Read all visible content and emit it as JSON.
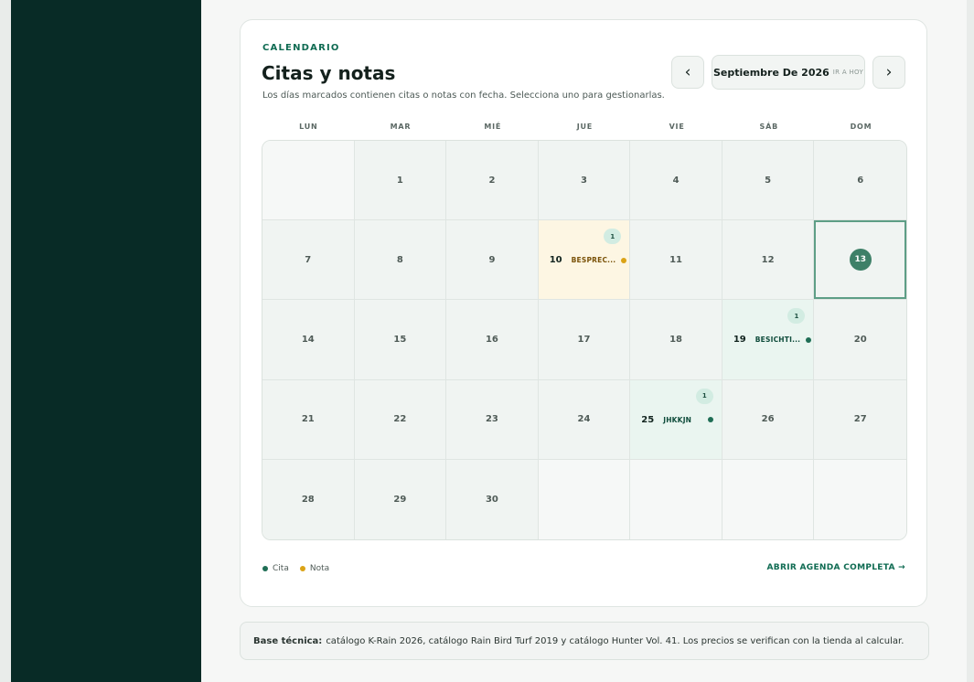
{
  "calendar": {
    "eyebrow": "CALENDARIO",
    "title": "Citas y notas",
    "subtitle": "Los días marcados contienen citas o notas con fecha. Selecciona uno para gestionarlas.",
    "prev_label": "‹",
    "next_label": "›",
    "month_label": "Septiembre De 2026",
    "today_label": "IR A HOY",
    "weekdays": [
      "LUN",
      "MAR",
      "MIÉ",
      "JUE",
      "VIE",
      "SÁB",
      "DOM"
    ],
    "cells": [
      {
        "day": ""
      },
      {
        "day": "1"
      },
      {
        "day": "2"
      },
      {
        "day": "3"
      },
      {
        "day": "4"
      },
      {
        "day": "5"
      },
      {
        "day": "6"
      },
      {
        "day": "7"
      },
      {
        "day": "8"
      },
      {
        "day": "9"
      },
      {
        "day": "10",
        "kind": "note",
        "count": "1",
        "event": "BESPREC..."
      },
      {
        "day": "11"
      },
      {
        "day": "12"
      },
      {
        "day": "13",
        "today": true
      },
      {
        "day": "14"
      },
      {
        "day": "15"
      },
      {
        "day": "16"
      },
      {
        "day": "17"
      },
      {
        "day": "18"
      },
      {
        "day": "19",
        "kind": "appt",
        "count": "1",
        "event": "BESICHTI..."
      },
      {
        "day": "20"
      },
      {
        "day": "21"
      },
      {
        "day": "22"
      },
      {
        "day": "23"
      },
      {
        "day": "24"
      },
      {
        "day": "25",
        "kind": "appt",
        "count": "1",
        "event": "JHKKJN"
      },
      {
        "day": "26"
      },
      {
        "day": "27"
      },
      {
        "day": "28"
      },
      {
        "day": "29"
      },
      {
        "day": "30"
      },
      {
        "day": ""
      },
      {
        "day": ""
      },
      {
        "day": ""
      },
      {
        "day": ""
      }
    ],
    "legend": {
      "appointment": "Cita",
      "note": "Nota"
    },
    "open_agenda": "ABRIR AGENDA COMPLETA →"
  },
  "footer": {
    "label": "Base técnica:",
    "text": "catálogo K-Rain 2026, catálogo Rain Bird Turf 2019 y catálogo Hunter Vol. 41. Los precios se verifican con la tienda al calcular."
  },
  "colors": {
    "sidebar": "#082b26",
    "accent": "#0f6b52",
    "appointment_dot": "#1f6e55",
    "note_dot": "#dba316",
    "today": "#3e8068"
  },
  "icons": {
    "prev": "chevron-left-icon",
    "next": "chevron-right-icon",
    "arrow": "arrow-right-icon"
  }
}
